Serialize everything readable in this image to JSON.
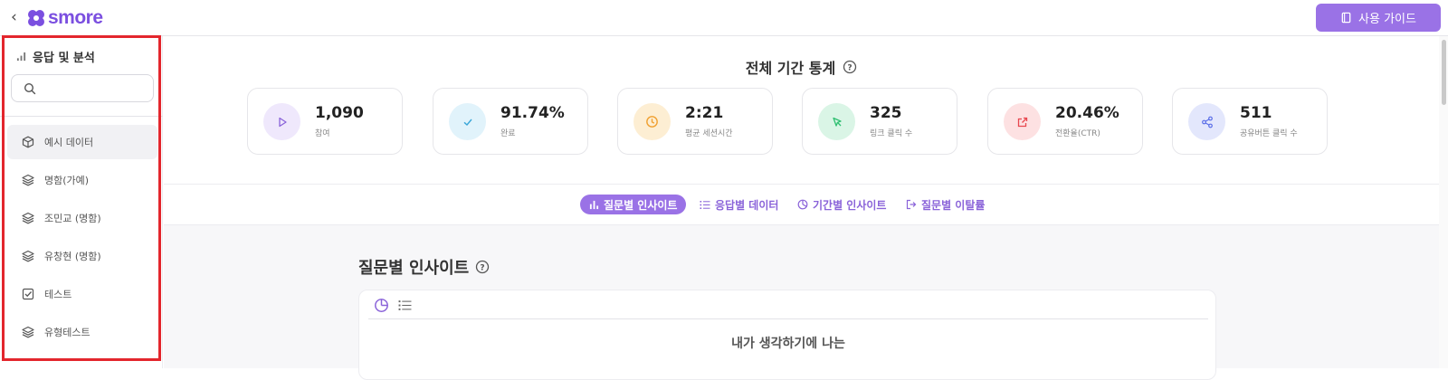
{
  "header": {
    "back_icon": "chevron-left-icon",
    "logo_text": "smore",
    "guide_label": "사용 가이드",
    "brand_color": "#9a72e6"
  },
  "sidebar": {
    "title": "응답 및 분석",
    "search_placeholder": "",
    "items": [
      {
        "label": "예시 데이터",
        "icon": "cube-icon",
        "active": true
      },
      {
        "label": "명함(가예)",
        "icon": "layers-icon"
      },
      {
        "label": "조민교 (명함)",
        "icon": "layers-icon"
      },
      {
        "label": "유창현 (명함)",
        "icon": "layers-icon"
      },
      {
        "label": "테스트",
        "icon": "checkbox-icon"
      },
      {
        "label": "유형테스트",
        "icon": "layers-icon"
      }
    ]
  },
  "stats": {
    "title": "전체 기간 통계",
    "cards": [
      {
        "value": "1,090",
        "label": "참여",
        "icon": "play-icon",
        "color": "#8a63d9"
      },
      {
        "value": "91.74%",
        "label": "완료",
        "icon": "check-icon",
        "color": "#3aa7d9"
      },
      {
        "value": "2:21",
        "label": "평균 세션시간",
        "icon": "clock-icon",
        "color": "#f0a030"
      },
      {
        "value": "325",
        "label": "링크 클릭 수",
        "icon": "cursor-icon",
        "color": "#2fbf71"
      },
      {
        "value": "20.46%",
        "label": "전환율(CTR)",
        "icon": "external-link-icon",
        "color": "#e8474f"
      },
      {
        "value": "511",
        "label": "공유버튼 클릭 수",
        "icon": "share-icon",
        "color": "#5a6ee8"
      }
    ]
  },
  "tabs": [
    {
      "label": "질문별 인사이트",
      "icon": "bar-chart-icon",
      "active": true
    },
    {
      "label": "응답별 데이터",
      "icon": "list-icon"
    },
    {
      "label": "기간별 인사이트",
      "icon": "pie-icon"
    },
    {
      "label": "질문별 이탈률",
      "icon": "exit-icon"
    }
  ],
  "section": {
    "title": "질문별 인사이트",
    "question_text": "내가 생각하기에 나는"
  }
}
